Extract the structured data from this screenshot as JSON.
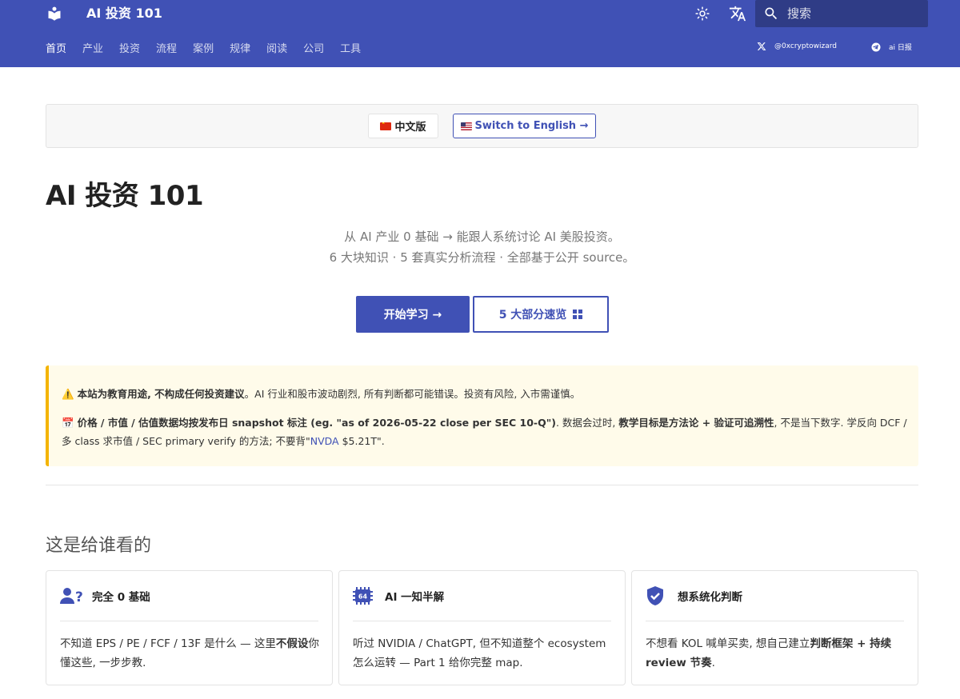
{
  "header": {
    "site_title": "AI 投资 101",
    "search_placeholder": "搜索",
    "nav": [
      "首页",
      "产业",
      "投资",
      "流程",
      "案例",
      "规律",
      "阅读",
      "公司",
      "工具"
    ],
    "social_x": "@0xcryptowizard",
    "social_tg": "ai 日报"
  },
  "lang_switch": {
    "cn_label": "中文版",
    "en_label": "Switch to English →"
  },
  "hero": {
    "title": "AI 投资 101",
    "tagline_1": "从 AI 产业 0 基础 → 能跟人系统讨论 AI 美股投资。",
    "tagline_2": "6 大块知识 · 5 套真实分析流程 · 全部基于公开 source。",
    "btn_start": "开始学习 →",
    "btn_overview": "5 大部分速览"
  },
  "warning": {
    "l1_icon": "⚠️",
    "l1_bold": "本站为教育用途, 不构成任何投资建议",
    "l1_rest": "。AI 行业和股市波动剧烈, 所有判断都可能错误。投资有风险, 入市需谨慎。",
    "l2_icon": "📅",
    "l2_bold1": "价格 / 市值 / 估值数据均按发布日 snapshot 标注 (eg. \"as of 2026-05-22 close per SEC 10-Q\")",
    "l2_mid1": ". 数据会过时, ",
    "l2_bold2": "教学目标是方法论 + 验证可追溯性",
    "l2_mid2": ", 不是当下数字. 学反向 DCF / 多 class 求市值 / SEC primary verify 的方法; 不要背\"",
    "l2_link": "NVDA",
    "l2_end": " $5.21T\"."
  },
  "audience": {
    "title": "这是给谁看的",
    "cards": [
      {
        "title": "完全 0 基础",
        "body_a": "不知道 EPS / PE / FCF / 13F 是什么 — 这里",
        "body_bold": "不假设",
        "body_b": "你懂这些, 一步步教."
      },
      {
        "title": "AI 一知半解",
        "body_a": "听过 NVIDIA / ChatGPT, 但不知道整个 ecosystem 怎么运转 — Part 1 给你完整 map.",
        "body_bold": "",
        "body_b": ""
      },
      {
        "title": "想系统化判断",
        "body_a": "不想看 KOL 喊单买卖, 想自己建立",
        "body_bold": "判断框架 + 持续 review 节奏",
        "body_b": "."
      }
    ]
  },
  "colors": {
    "primary": "#4051b5",
    "warning_border": "#f4b400",
    "warning_bg": "#fffbea"
  }
}
